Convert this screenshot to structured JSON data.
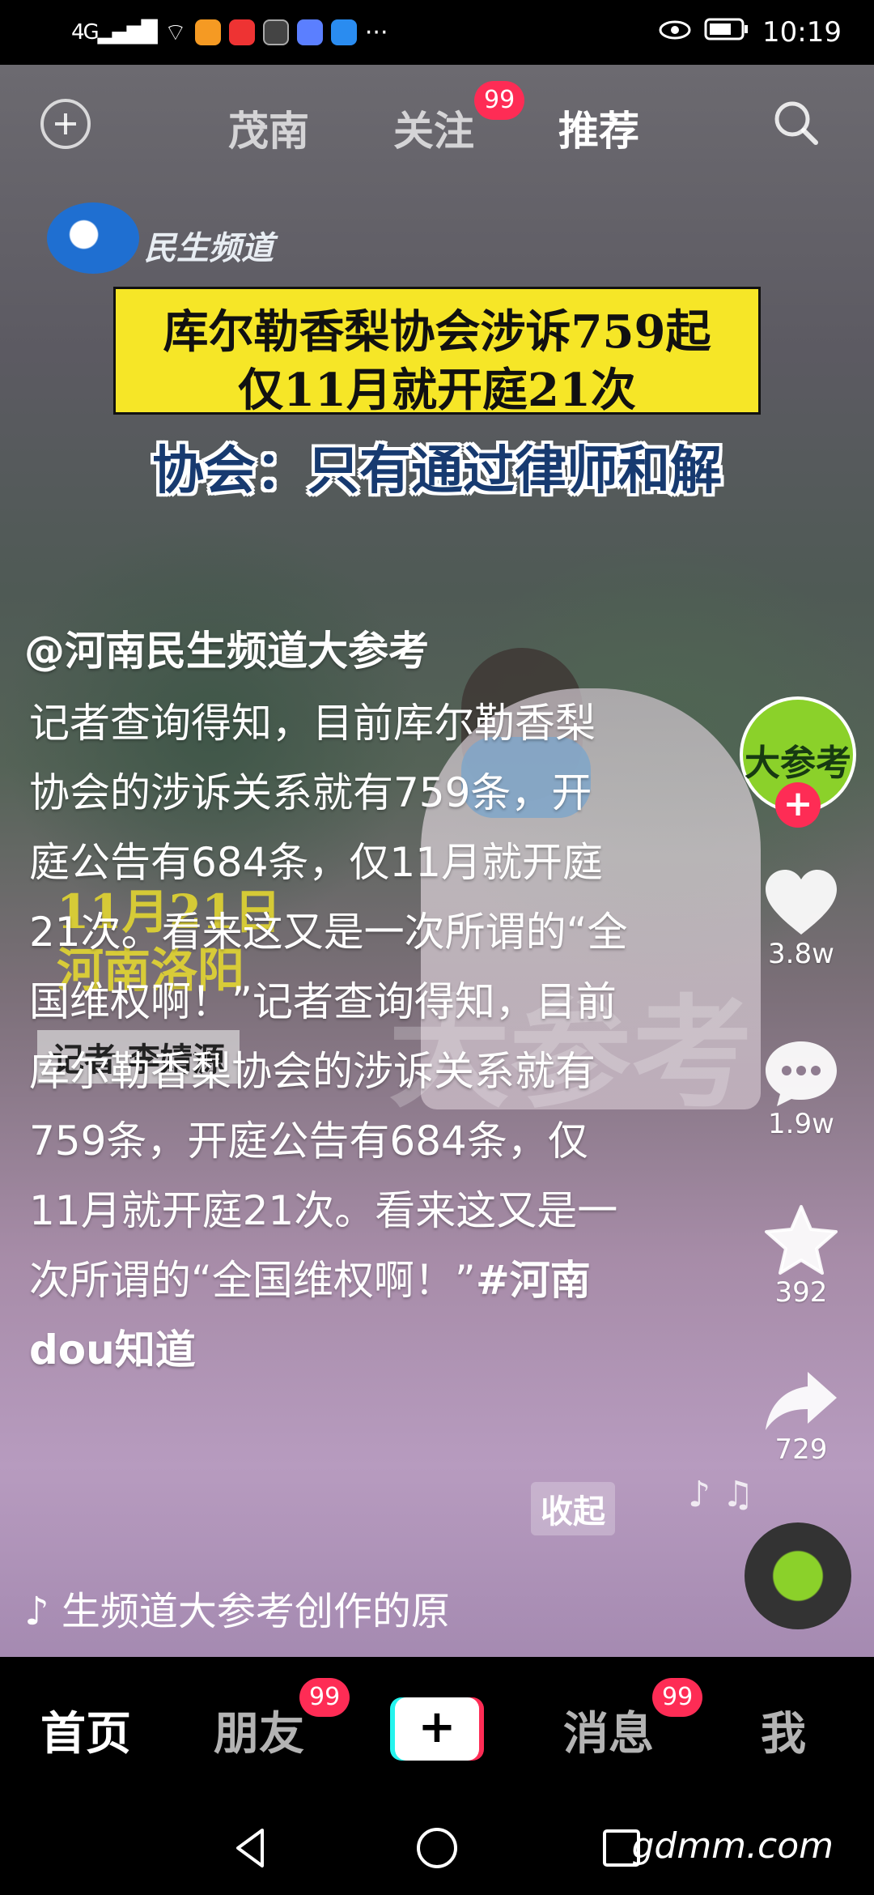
{
  "status_bar": {
    "network": "4G",
    "time": "10:19",
    "more": "···"
  },
  "top_nav": {
    "tabs": [
      {
        "label": "茂南"
      },
      {
        "label": "关注",
        "badge": "99"
      },
      {
        "label": "推荐"
      }
    ]
  },
  "video": {
    "logo_text": "民生频道",
    "headline_line1": "库尔勒香梨协会涉诉759起",
    "headline_line2": "仅11月就开庭21次",
    "subheadline": "协会：只有通过律师和解",
    "overlay_date_line1": "11月21日",
    "overlay_date_line2": "河南洛阳",
    "overlay_reporter": "记者 李婧源",
    "watermark": "大参考"
  },
  "post": {
    "author": "@河南民生频道大参考",
    "caption_text": "记者查询得知，目前库尔勒香梨协会的涉诉关系就有759条，开庭公告有684条，仅11月就开庭21次。看来这又是一次所谓的“全国维权啊！”记者查询得知，目前库尔勒香梨协会的涉诉关系就有759条，开庭公告有684条，仅11月就开庭21次。看来这又是一次所谓的“全国维权啊！”",
    "hashtag": "#河南dou知道",
    "collapse_label": "收起",
    "music_text": "♪ 生频道大参考创作的原"
  },
  "actions": {
    "avatar_text": "大参考",
    "follow_plus": "+",
    "likes": "3.8w",
    "comments": "1.9w",
    "favorites": "392",
    "shares": "729"
  },
  "bottom_nav": {
    "tabs": [
      {
        "label": "首页"
      },
      {
        "label": "朋友",
        "badge": "99"
      },
      {
        "label": "+"
      },
      {
        "label": "消息",
        "badge": "99"
      },
      {
        "label": "我"
      }
    ]
  },
  "system_nav": {
    "watermark": "gdmm.com"
  },
  "colors": {
    "accent_red": "#fe2c55",
    "accent_cyan": "#25f4ee",
    "headline_yellow": "#f6e627"
  }
}
